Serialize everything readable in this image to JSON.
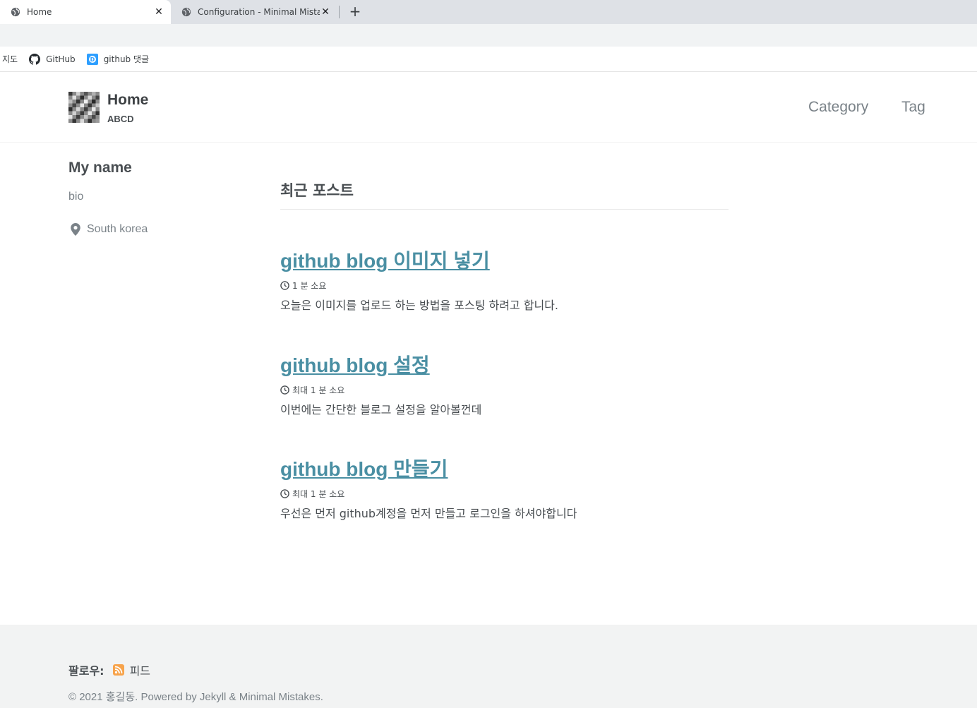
{
  "browser": {
    "tabs": [
      {
        "title": "Home",
        "active": true,
        "icon": "globe-icon"
      },
      {
        "title": "Configuration - Minimal Mistake",
        "active": false,
        "icon": "globe-icon"
      }
    ],
    "bookmarks": [
      {
        "label": "지도",
        "icon": ""
      },
      {
        "label": "GitHub",
        "icon": "github-icon"
      },
      {
        "label": "github 댓글",
        "icon": "disqus-icon"
      }
    ]
  },
  "masthead": {
    "title": "Home",
    "subtitle": "ABCD",
    "nav": [
      {
        "label": "Category"
      },
      {
        "label": "Tag"
      }
    ]
  },
  "author": {
    "name": "My name",
    "bio": "bio",
    "location": "South korea"
  },
  "main": {
    "section_title": "최근 포스트",
    "posts": [
      {
        "title": "github blog 이미지 넣기",
        "read_time": "1 분 소요",
        "excerpt": "오늘은 이미지를 업로드 하는 방법을 포스팅 하려고 합니다."
      },
      {
        "title": "github blog 설정",
        "read_time": "최대 1 분 소요",
        "excerpt": "이번에는 간단한 블로그 설정을 알아볼껀데"
      },
      {
        "title": "github blog 만들기",
        "read_time": "최대 1 분 소요",
        "excerpt": "우선은 먼저 github계정을 먼저 만들고 로그인을 하셔야합니다"
      }
    ]
  },
  "footer": {
    "follow_label": "팔로우:",
    "feed_label": "피드",
    "copyright": "© 2021 홍길동. Powered by Jekyll & Minimal Mistakes."
  },
  "colors": {
    "link": "#4a8fa3",
    "text": "#494e52",
    "muted": "#7a8288",
    "footer_bg": "#f2f3f3",
    "rss": "#f7a34b"
  }
}
